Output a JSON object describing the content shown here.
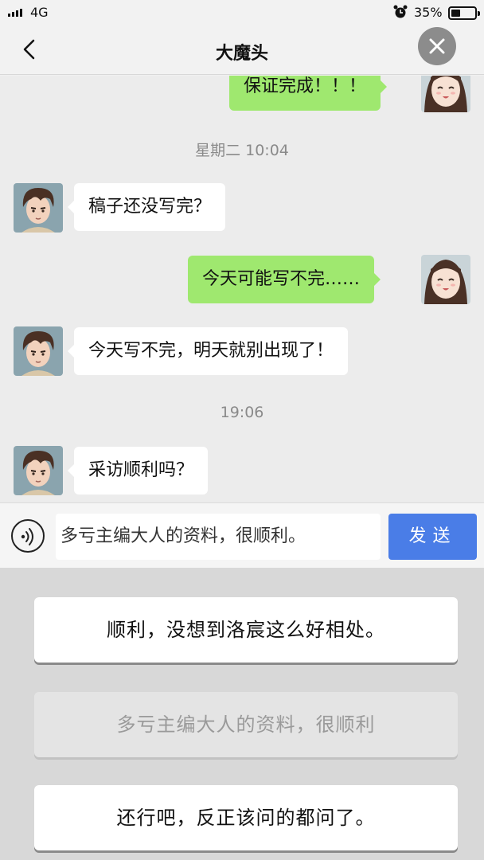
{
  "status_bar": {
    "network": "4G",
    "battery": "35%"
  },
  "nav": {
    "title": "大魔头"
  },
  "chat": {
    "messages": [
      {
        "side": "right",
        "text": "保证完成！！！"
      },
      {
        "time": "星期二  10:04"
      },
      {
        "side": "left",
        "text": "稿子还没写完？"
      },
      {
        "side": "right",
        "text": "今天可能写不完……"
      },
      {
        "side": "left",
        "text": "今天写不完，明天就别出现了！"
      },
      {
        "time": "19:06"
      },
      {
        "side": "left",
        "text": "采访顺利吗？"
      }
    ]
  },
  "input": {
    "value": "多亏主编大人的资料，很顺利。",
    "send_label": "发送"
  },
  "options": [
    {
      "text": "顺利，没想到洛宸这么好相处。",
      "state": "active"
    },
    {
      "text": "多亏主编大人的资料，很顺利",
      "state": "disabled"
    },
    {
      "text": "还行吧，反正该问的都问了。",
      "state": "active"
    }
  ],
  "colors": {
    "send_button": "#4a7de7",
    "outgoing_bubble": "#9fe86f",
    "close_button": "#8c8c8c"
  }
}
